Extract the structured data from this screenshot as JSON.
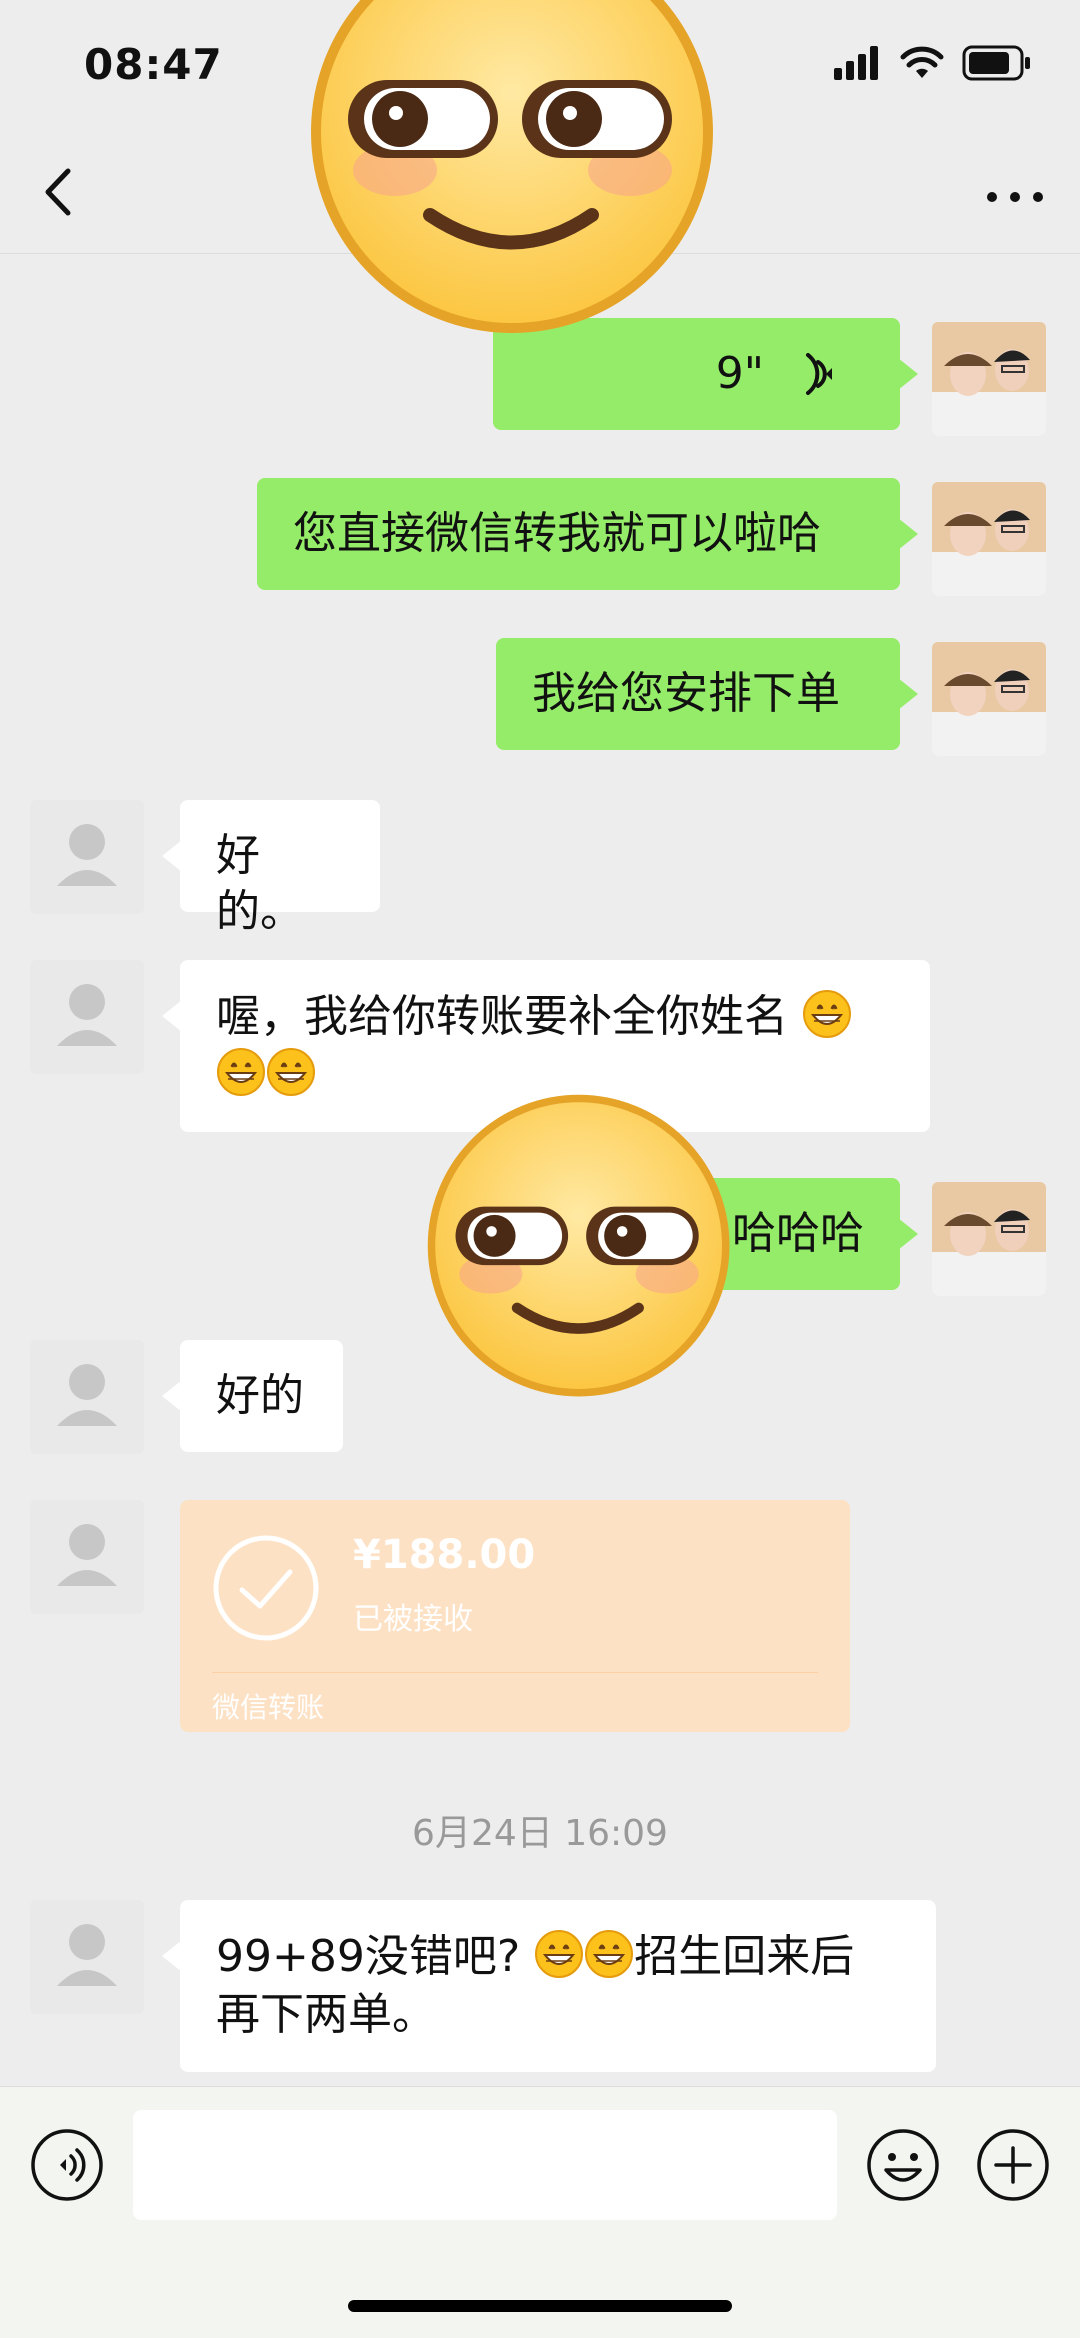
{
  "status_bar": {
    "time": "08:47"
  },
  "messages": [
    {
      "id": "voice",
      "side": "me",
      "duration": "9\""
    },
    {
      "id": "m2",
      "side": "me",
      "text": "您直接微信转我就可以啦哈"
    },
    {
      "id": "m3",
      "side": "me",
      "text": "我给您安排下单"
    },
    {
      "id": "m4",
      "side": "other",
      "text": "好的。"
    },
    {
      "id": "m5",
      "side": "other",
      "text": "喔，我给你转账要补全你姓名"
    },
    {
      "id": "m6",
      "side": "me",
      "text": "哈哈哈"
    },
    {
      "id": "m7",
      "side": "other",
      "text": "好的"
    },
    {
      "id": "m9",
      "side": "other",
      "text_a": "99+89没错吧?",
      "text_b": "招生回来后",
      "text_c": "再下两单。"
    }
  ],
  "transfer": {
    "amount": "¥188.00",
    "status": "已被接收",
    "label": "微信转账"
  },
  "timestamp": "6月24日 16:09",
  "icons": {
    "back": "chevron-left-icon",
    "more": "more-dots-icon",
    "voice_toggle": "voice-input-icon",
    "emoji": "emoji-icon",
    "add": "plus-icon"
  },
  "colors": {
    "my_bubble": "#95ec69",
    "their_bubble": "#ffffff",
    "transfer_card": "#fde1c4",
    "background": "#ededed"
  }
}
